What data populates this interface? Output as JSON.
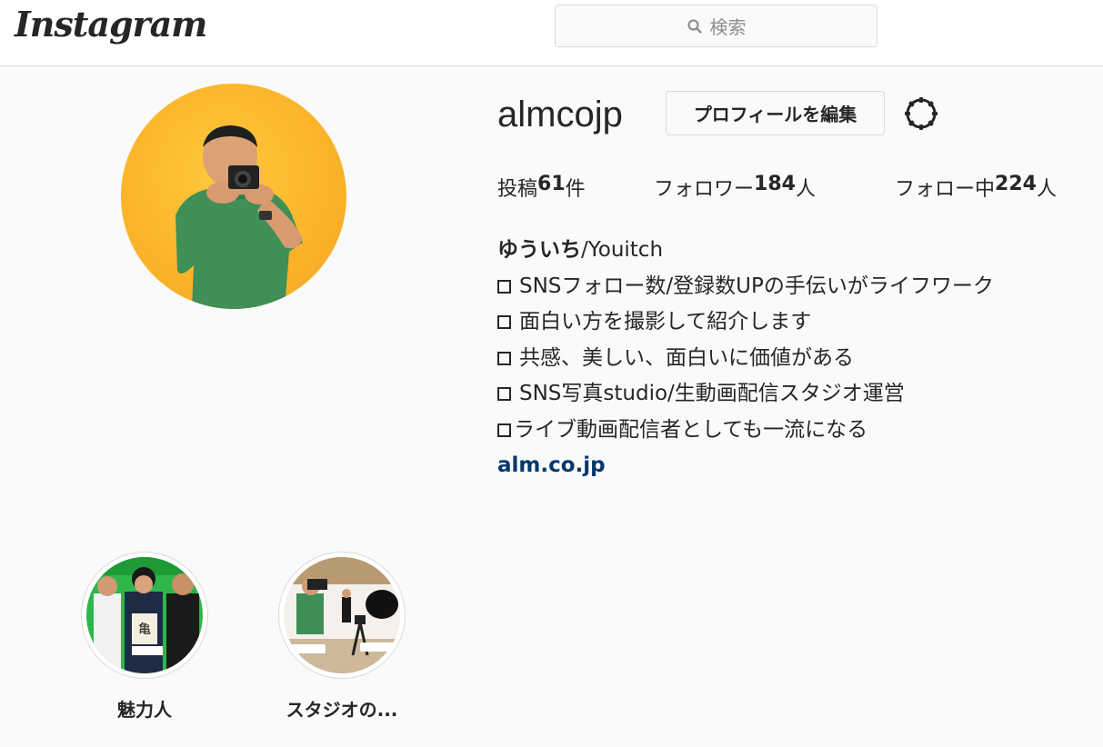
{
  "header": {
    "logo": "Instagram",
    "search_placeholder": "検索"
  },
  "profile": {
    "username": "almcojp",
    "edit_button": "プロフィールを編集",
    "stats": {
      "posts_label": "投稿",
      "posts_count": "61",
      "posts_unit": "件",
      "followers_label": "フォロワー",
      "followers_count": "184",
      "followers_unit": "人",
      "following_label": "フォロー中",
      "following_count": "224",
      "following_unit": "人"
    },
    "bio": {
      "name_bold": "ゆういち",
      "name_rest": "/Youitch",
      "lines": [
        "SNSフォロー数/登録数UPの手伝いがライフワーク",
        "面白い方を撮影して紹介します",
        "共感、美しい、面白いに価値がある",
        "SNS写真studio/生動画配信スタジオ運営",
        "ライブ動画配信者としても一流になる"
      ],
      "link": "alm.co.jp"
    }
  },
  "highlights": [
    {
      "label": "魅力人"
    },
    {
      "label": "スタジオの..."
    }
  ],
  "colors": {
    "avatar_bg": "#fbb52a",
    "link": "#00376b",
    "border": "#dbdbdb"
  },
  "icons": {
    "search": "search-icon",
    "settings": "gear-icon"
  }
}
